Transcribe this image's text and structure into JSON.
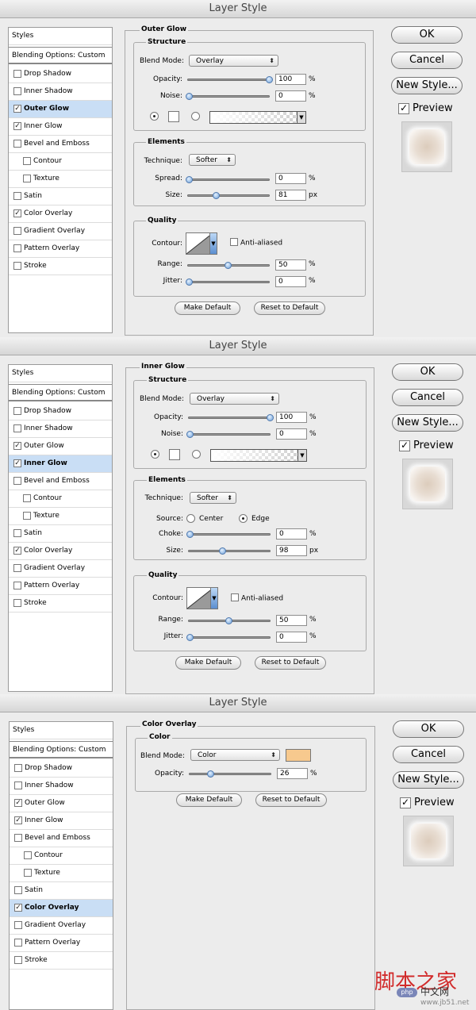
{
  "dialogs": [
    {
      "title": "Layer Style",
      "section_title": "Outer Glow",
      "styles": [
        "Styles",
        "Blending Options: Custom",
        "Drop Shadow",
        "Inner Shadow",
        "Outer Glow",
        "Inner Glow",
        "Bevel and Emboss",
        "Contour",
        "Texture",
        "Satin",
        "Color Overlay",
        "Gradient Overlay",
        "Pattern Overlay",
        "Stroke"
      ],
      "checked": [
        false,
        false,
        false,
        false,
        true,
        true,
        false,
        false,
        false,
        false,
        true,
        false,
        false,
        false
      ],
      "structure_label": "Structure",
      "blend_mode_label": "Blend Mode:",
      "blend_mode_value": "Overlay",
      "opacity_label": "Opacity:",
      "opacity_value": "100",
      "opacity_level": 100,
      "noise_label": "Noise:",
      "noise_value": "0",
      "noise_level": 0,
      "percent": "%",
      "px": "px",
      "elements_label": "Elements",
      "technique_label": "Technique:",
      "technique_value": "Softer",
      "spread_label": "Spread:",
      "spread_value": "0",
      "spread_level": 0,
      "size_label": "Size:",
      "size_value": "81",
      "size_level": 32,
      "quality_label": "Quality",
      "contour_label": "Contour:",
      "anti_aliased_label": "Anti-aliased",
      "range_label": "Range:",
      "range_value": "50",
      "range_level": 50,
      "jitter_label": "Jitter:",
      "jitter_value": "0",
      "jitter_level": 0,
      "make_default": "Make Default",
      "reset_default": "Reset to Default",
      "ok": "OK",
      "cancel": "Cancel",
      "new_style": "New Style...",
      "preview": "Preview"
    },
    {
      "title": "Layer Style",
      "section_title": "Inner Glow",
      "styles": [
        "Styles",
        "Blending Options: Custom",
        "Drop Shadow",
        "Inner Shadow",
        "Outer Glow",
        "Inner Glow",
        "Bevel and Emboss",
        "Contour",
        "Texture",
        "Satin",
        "Color Overlay",
        "Gradient Overlay",
        "Pattern Overlay",
        "Stroke"
      ],
      "checked": [
        false,
        false,
        false,
        false,
        true,
        true,
        false,
        false,
        false,
        false,
        true,
        false,
        false,
        false
      ],
      "structure_label": "Structure",
      "blend_mode_label": "Blend Mode:",
      "blend_mode_value": "Overlay",
      "opacity_label": "Opacity:",
      "opacity_value": "100",
      "opacity_level": 100,
      "noise_label": "Noise:",
      "noise_value": "0",
      "noise_level": 0,
      "percent": "%",
      "px": "px",
      "elements_label": "Elements",
      "technique_label": "Technique:",
      "technique_value": "Softer",
      "source_label": "Source:",
      "center_label": "Center",
      "edge_label": "Edge",
      "choke_label": "Choke:",
      "choke_value": "0",
      "choke_level": 0,
      "size_label": "Size:",
      "size_value": "98",
      "size_level": 39,
      "quality_label": "Quality",
      "contour_label": "Contour:",
      "anti_aliased_label": "Anti-aliased",
      "range_label": "Range:",
      "range_value": "50",
      "range_level": 50,
      "jitter_label": "Jitter:",
      "jitter_value": "0",
      "jitter_level": 0,
      "make_default": "Make Default",
      "reset_default": "Reset to Default",
      "ok": "OK",
      "cancel": "Cancel",
      "new_style": "New Style...",
      "preview": "Preview"
    },
    {
      "title": "Layer Style",
      "section_title": "Color Overlay",
      "styles": [
        "Styles",
        "Blending Options: Custom",
        "Drop Shadow",
        "Inner Shadow",
        "Outer Glow",
        "Inner Glow",
        "Bevel and Emboss",
        "Contour",
        "Texture",
        "Satin",
        "Color Overlay",
        "Gradient Overlay",
        "Pattern Overlay",
        "Stroke"
      ],
      "checked": [
        false,
        false,
        false,
        false,
        true,
        true,
        false,
        false,
        false,
        false,
        true,
        false,
        false,
        false
      ],
      "color_label": "Color",
      "blend_mode_label": "Blend Mode:",
      "blend_mode_value": "Color",
      "overlay_color": "#f7c98e",
      "opacity_label": "Opacity:",
      "opacity_value": "26",
      "opacity_level": 26,
      "percent": "%",
      "make_default": "Make Default",
      "reset_default": "Reset to Default",
      "ok": "OK",
      "cancel": "Cancel",
      "new_style": "New Style...",
      "preview": "Preview"
    }
  ],
  "watermark": {
    "cn": "脚本之家",
    "php": "php",
    "cnwang": "中文网",
    "url": "www.jb51.net"
  }
}
